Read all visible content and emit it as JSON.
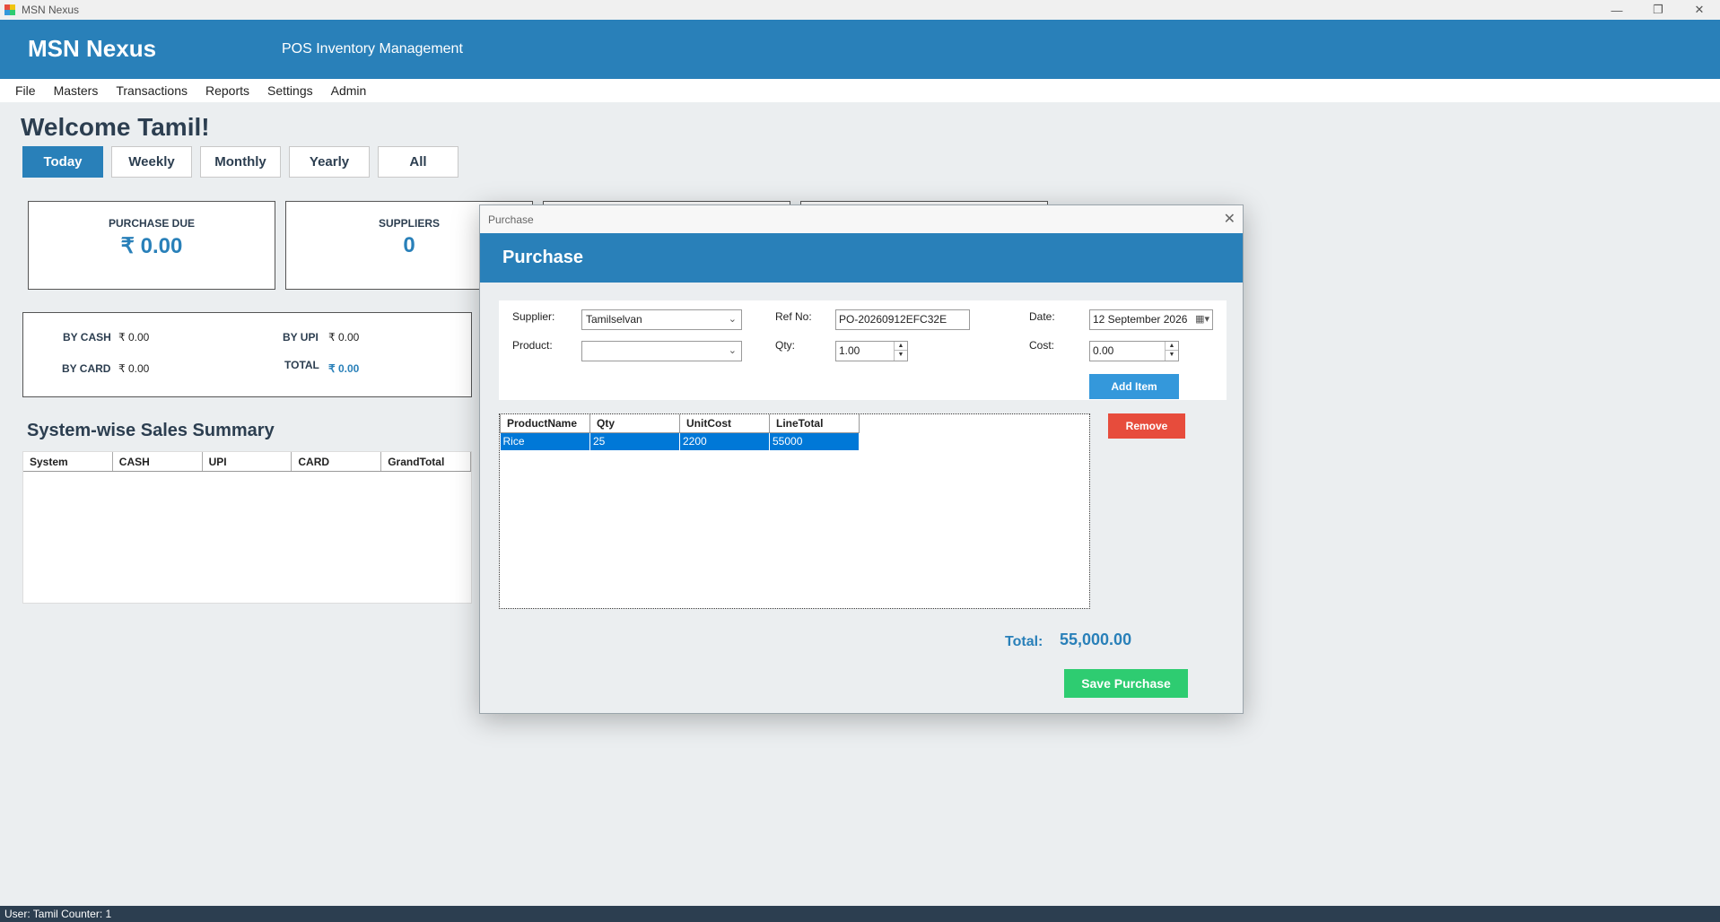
{
  "window": {
    "title": "MSN Nexus",
    "minimize": "—",
    "maximize": "❐",
    "close": "✕"
  },
  "header": {
    "brand": "MSN Nexus",
    "subtitle": "POS  Inventory Management"
  },
  "menu": [
    "File",
    "Masters",
    "Transactions",
    "Reports",
    "Settings",
    "Admin"
  ],
  "welcome": "Welcome Tamil!",
  "period_tabs": [
    "Today",
    "Weekly",
    "Monthly",
    "Yearly",
    "All"
  ],
  "active_period": "Today",
  "cards": [
    {
      "label": "PURCHASE DUE",
      "value": "₹ 0.00"
    },
    {
      "label": "SUPPLIERS",
      "value": "0"
    }
  ],
  "payments": {
    "by_cash_label": "BY CASH",
    "by_cash": "₹ 0.00",
    "by_upi_label": "BY UPI",
    "by_upi": "₹ 0.00",
    "by_card_label": "BY CARD",
    "by_card": "₹ 0.00",
    "total_label": "TOTAL",
    "total": "₹ 0.00"
  },
  "summary": {
    "title": "System-wise Sales Summary",
    "columns": [
      "System",
      "CASH",
      "UPI",
      "CARD",
      "GrandTotal"
    ]
  },
  "status_bar": "User: Tamil  Counter: 1",
  "dialog": {
    "window_title": "Purchase",
    "close": "✕",
    "header": "Purchase",
    "supplier_label": "Supplier:",
    "supplier_value": "Tamilselvan",
    "product_label": "Product:",
    "product_value": "",
    "ref_label": "Ref No:",
    "ref_value": "PO-20260912EFC32E",
    "qty_label": "Qty:",
    "qty_value": "1.00",
    "date_label": "Date:",
    "date_value": "12 September 2026",
    "cost_label": "Cost:",
    "cost_value": "0.00",
    "add_item": "Add Item",
    "remove": "Remove",
    "grid_columns": [
      "ProductName",
      "Qty",
      "UnitCost",
      "LineTotal"
    ],
    "grid_rows": [
      [
        "Rice",
        "25",
        "2200",
        "55000"
      ]
    ],
    "total_label": "Total:",
    "total_value": "55,000.00",
    "save": "Save Purchase"
  },
  "colors": {
    "brand": "#2980b9",
    "add": "#3498db",
    "remove": "#e74c3c",
    "save": "#2ecc71",
    "selection": "#0078d7"
  }
}
